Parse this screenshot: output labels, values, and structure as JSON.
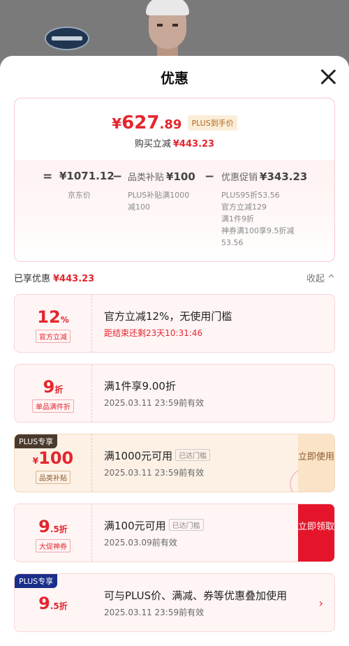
{
  "sheet": {
    "title": "优惠"
  },
  "summary": {
    "yen": "¥",
    "price_int": "627",
    "price_dec": ".89",
    "plus_tag": "PLUS到手价",
    "instant_label": "购买立减",
    "instant_amount": "¥443.23",
    "eq": "=",
    "minus": "−",
    "jd_price": "¥1071.12",
    "jd_label": "京东价",
    "subsidy_label": "品类补贴",
    "subsidy_amount": "¥100",
    "subsidy_note1": "PLUS补贴满1000",
    "subsidy_note2": "减100",
    "promo_label": "优惠促销",
    "promo_amount": "¥343.23",
    "promo_note1": "PLUS95折53.56",
    "promo_note2": "官方立减129",
    "promo_note3": "满1件9折",
    "promo_note4": "神券满100享9.5折减",
    "promo_note5": "53.56"
  },
  "enjoyed": {
    "label": "已享优惠",
    "amount": "¥443.23",
    "collapse": "收起 ^"
  },
  "coupons": [
    {
      "value": "12",
      "unit": "%",
      "tag": "官方立减",
      "title": "官方立减12%，无使用门槛",
      "subtitle": "距结束还剩23天10:31:46"
    },
    {
      "value": "9",
      "unit": "折",
      "tag": "单品满件折",
      "title": "满1件享9.00折",
      "subtitle": "2025.03.11 23:59前有效"
    },
    {
      "flag": "PLUS专享",
      "value": "100",
      "unit": "¥",
      "tag": "品类补贴",
      "title": "满1000元可用",
      "met": "已达门槛",
      "subtitle": "2025.03.11 23:59前有效",
      "action": "立即使用",
      "stamp": "已领"
    },
    {
      "value": "9",
      "value_dec": ".5",
      "unit": "折",
      "tag": "大促神券",
      "title": "满100元可用",
      "met": "已达门槛",
      "subtitle": "2025.03.09前有效",
      "action": "立即领取"
    },
    {
      "flag": "PLUS专享",
      "value": "9",
      "value_dec": ".5",
      "unit": "折",
      "title": "可与PLUS价、满减、券等优惠叠加使用",
      "subtitle": "2025.03.11 23:59前有效",
      "chevron": "›"
    }
  ],
  "colors": {
    "accent": "#e4262e",
    "claim_bg": "#e4152b",
    "gold_bg": "#fdf1e6"
  }
}
